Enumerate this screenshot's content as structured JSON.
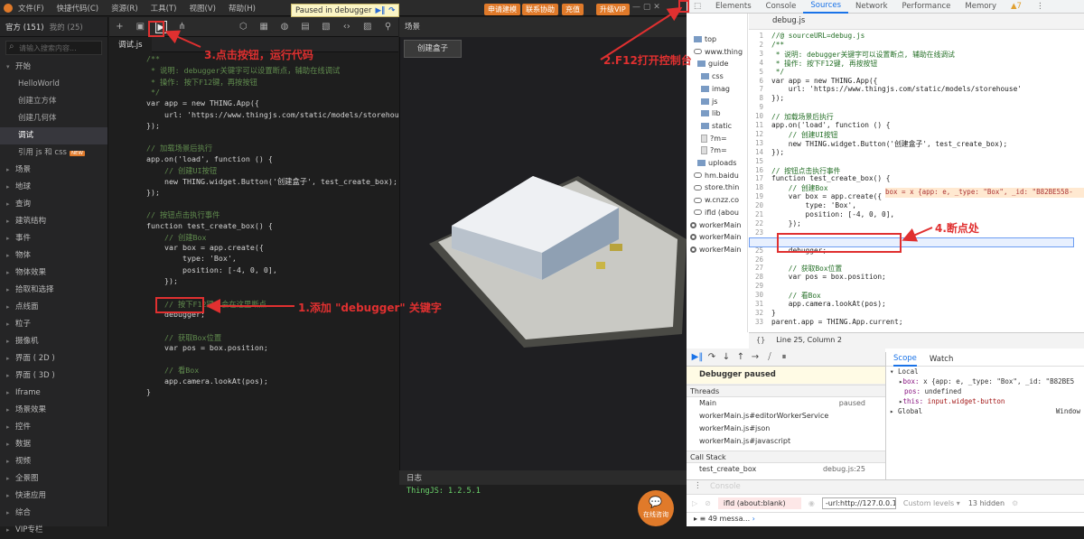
{
  "ide": {
    "menu": [
      "文件(F)",
      "快捷代码(C)",
      "资源(R)",
      "工具(T)",
      "视图(V)",
      "帮助(H)"
    ],
    "paused_label": "Paused in debugger",
    "top_buttons": [
      "申请建模",
      "联系协助",
      "充值",
      "升级VIP"
    ],
    "sidebar": {
      "tab_official": "官方 (151)",
      "tab_mine": "我的 (25)",
      "search_placeholder": "请输入搜索内容...",
      "open_group": "开始",
      "children": [
        "HelloWorld",
        "创建立方体",
        "创建几何体",
        "调试",
        "引用 js 和 css"
      ],
      "new_tag": "NEW",
      "groups": [
        "场景",
        "地球",
        "查询",
        "建筑结构",
        "事件",
        "物体",
        "物体效果",
        "拾取和选择",
        "点线面",
        "粒子",
        "摄像机",
        "界面 ( 2D )",
        "界面 ( 3D )",
        "Iframe",
        "场景效果",
        "控件",
        "数据",
        "视频",
        "全景图",
        "快速应用",
        "综合",
        "VIP专栏"
      ]
    },
    "editor_tab": "调试.js",
    "code_lines": [
      "/**",
      " * 说明: debugger关键字可以设置断点，辅助在线调试",
      " * 操作: 按下F12键，再按按钮",
      " */",
      "var app = new THING.App({",
      "    url: 'https://www.thingjs.com/static/models/storehouse'",
      "});",
      "",
      "// 加载场景后执行",
      "app.on('load', function () {",
      "    // 创建UI按钮",
      "    new THING.widget.Button('创建盒子', test_create_box);",
      "});",
      "",
      "// 按钮点击执行事件",
      "function test_create_box() {",
      "    // 创建Box",
      "    var box = app.create({",
      "        type: 'Box',",
      "        position: [-4, 0, 0],",
      "    });",
      "",
      "    // 按下F12键，会在这里断点",
      "    debugger;",
      "",
      "    // 获取Box位置",
      "    var pos = box.position;",
      "",
      "    // 看Box",
      "    app.camera.lookAt(pos);",
      "}"
    ],
    "scene_title": "场景",
    "scene_button": "创建盒子",
    "log_title": "日志",
    "log_text": "ThingJS: 1.2.5.1",
    "help_label": "在线咨询"
  },
  "devtools": {
    "tabs": [
      "Elements",
      "Console",
      "Sources",
      "Network",
      "Performance",
      "Memory"
    ],
    "warn_count": "▲7",
    "nav": [
      "top",
      "www.thing",
      "guide",
      "css",
      "imag",
      "js",
      "lib",
      "static",
      "?m=",
      "?m=",
      "uploads",
      "hm.baidu",
      "store.thin",
      "w.cnzz.co",
      "ifld (abou",
      "workerMain",
      "workerMain",
      "workerMain"
    ],
    "file_tab": "debug.js",
    "code_lines": [
      "//@ sourceURL=debug.js",
      "/**",
      " * 说明: debugger关键字可以设置断点, 辅助在线调试",
      " * 操作: 按下F12键, 再按按钮",
      " */",
      "var app = new THING.App({",
      "    url: 'https://www.thingjs.com/static/models/storehouse'",
      "});",
      "",
      "// 加载场景后执行",
      "app.on('load', function () {",
      "    // 创建UI按钮",
      "    new THING.widget.Button('创建盒子', test_create_box);",
      "});",
      "",
      "// 按钮点击执行事件",
      "function test_create_box() {",
      "    // 创建Box",
      "    var box = app.create({",
      "        type: 'Box',",
      "        position: [-4, 0, 0],",
      "    });",
      "",
      "    // 按下F12键，会在这里断点",
      "    debugger;",
      "",
      "    // 获取Box位置",
      "    var pos = box.position;",
      "",
      "    // 看Box",
      "    app.camera.lookAt(pos);",
      "}",
      "parent.app = THING.App.current;"
    ],
    "line_numbers": [
      "1",
      "2",
      "3",
      "4",
      "5",
      "6",
      "7",
      "8",
      "9",
      "10",
      "11",
      "12",
      "13",
      "14",
      "15",
      "16",
      "17",
      "18",
      "19",
      "20",
      "21",
      "22",
      "23",
      "24",
      "25",
      "26",
      "27",
      "28",
      "29",
      "30",
      "31",
      "32",
      "33"
    ],
    "inline_value": "box = x {app: e, _type: \"Box\", _id: \"B82BE558-",
    "status": "Line 25, Column 2",
    "paused_msg": "Debugger paused",
    "threads_header": "Threads",
    "threads": [
      {
        "name": "Main",
        "state": "paused"
      },
      {
        "name": "workerMain.js#editorWorkerService",
        "state": ""
      },
      {
        "name": "workerMain.js#json",
        "state": ""
      },
      {
        "name": "workerMain.js#javascript",
        "state": ""
      }
    ],
    "callstack_header": "Call Stack",
    "callstack": [
      {
        "name": "test_create_box",
        "loc": "debug.js:25"
      }
    ],
    "scope_tabs": [
      "Scope",
      "Watch"
    ],
    "scope_local": "Local",
    "scope_rows": [
      {
        "k": "box:",
        "v": " x {app: e, _type: \"Box\", _id: \"B82BE5"
      },
      {
        "k": "pos:",
        "v": " undefined"
      },
      {
        "k": "this:",
        "v": " input.widget-button"
      }
    ],
    "scope_global": "Global",
    "scope_global_val": "Window",
    "console_tab": "Console",
    "console_ctx": "ifld (about:blank)",
    "console_filter": "-url:http://127.0.0.1/",
    "console_levels": "Custom levels ▾",
    "console_hidden": "13 hidden",
    "console_msgs": "49 messa..."
  },
  "annotations": {
    "a1": "1.添加 \"debugger\" 关键字",
    "a2": "2.F12打开控制台",
    "a3": "3.点击按钮，运行代码",
    "a4": "4.断点处"
  },
  "colors": {
    "accent": "#e07a2a",
    "annotation": "#e03030",
    "devtools_blue": "#1a73e8"
  }
}
